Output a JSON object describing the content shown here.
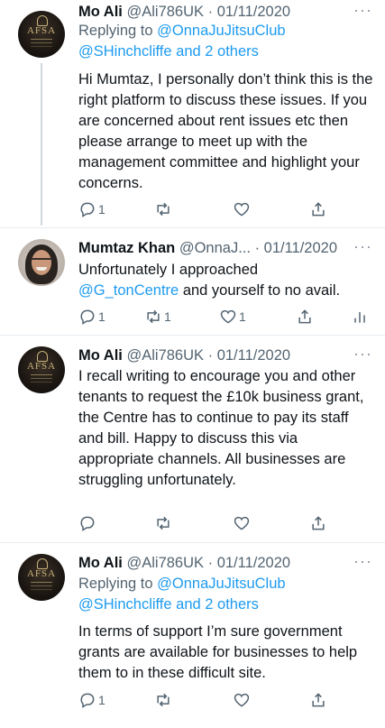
{
  "tweets": [
    {
      "name": "Mo Ali",
      "handle": "@Ali786UK",
      "date": "· 01/11/2020",
      "more": "···",
      "replying_label": "Replying to",
      "replying_user": "@OnnaJuJitsuClub",
      "replying_others": "@SHinchcliffe and 2 others",
      "text": "Hi Mumtaz, I personally don’t think this is the right platform to discuss these issues. If you are concerned about rent issues etc then please arrange to meet up with the management committee and highlight your concerns.",
      "reply_count": "1",
      "retweet_count": "",
      "like_count": ""
    },
    {
      "name": "Mumtaz Khan",
      "handle": "@OnnaJ...",
      "date": "· 01/11/2020",
      "more": "···",
      "text_pre": "Unfortunately I approached",
      "text_mention": "@G_tonCentre",
      "text_post": " and yourself to no avail.",
      "reply_count": "1",
      "retweet_count": "1",
      "like_count": "1"
    },
    {
      "name": "Mo Ali",
      "handle": "@Ali786UK",
      "date": "· 01/11/2020",
      "more": "···",
      "text": "I recall writing to encourage you and other tenants to request the £10k business grant, the Centre has to continue to pay its staff and bill. Happy to discuss this via appropriate channels. All businesses are struggling unfortunately.",
      "reply_count": "",
      "retweet_count": "",
      "like_count": ""
    },
    {
      "name": "Mo Ali",
      "handle": "@Ali786UK",
      "date": "· 01/11/2020",
      "more": "···",
      "replying_label": "Replying to",
      "replying_user": "@OnnaJuJitsuClub",
      "replying_others": "@SHinchcliffe and 2 others",
      "text": "In terms of support I’m sure government grants are available for businesses to help them to in these difficult site.",
      "reply_count": "1",
      "retweet_count": "",
      "like_count": ""
    }
  ],
  "avatar_logo_text": "AFSA",
  "colors": {
    "link": "#1d9bf0",
    "meta": "#536471",
    "separator": "#e6ecf0"
  }
}
